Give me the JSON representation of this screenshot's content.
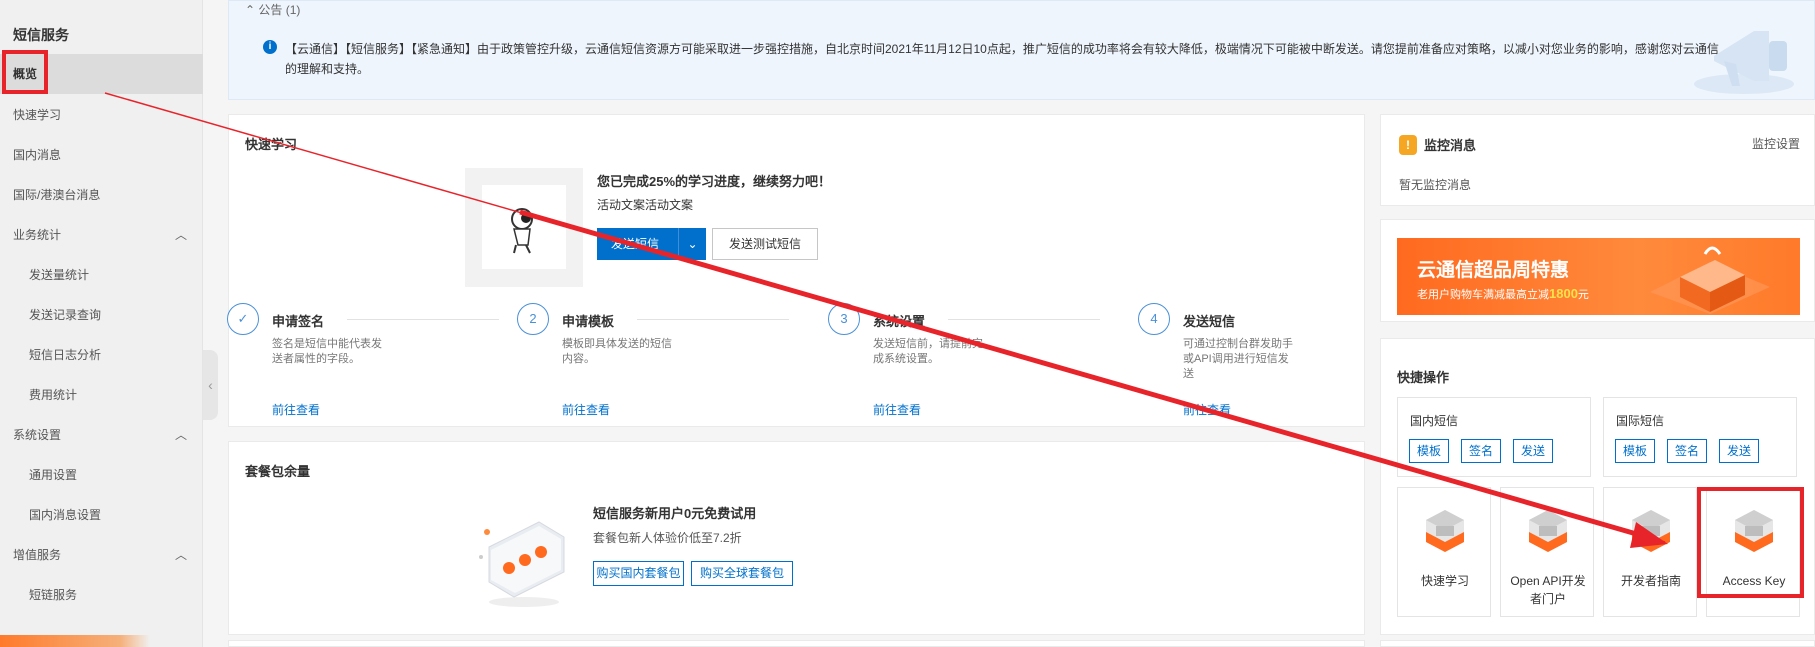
{
  "sidebar": {
    "title": "短信服务",
    "active_item": "概览",
    "items": [
      {
        "label": "快速学习",
        "sub": false,
        "expandable": false
      },
      {
        "label": "国内消息",
        "sub": false,
        "expandable": false
      },
      {
        "label": "国际/港澳台消息",
        "sub": false,
        "expandable": false
      },
      {
        "label": "业务统计",
        "sub": false,
        "expandable": true
      },
      {
        "label": "发送量统计",
        "sub": true,
        "expandable": false
      },
      {
        "label": "发送记录查询",
        "sub": true,
        "expandable": false
      },
      {
        "label": "短信日志分析",
        "sub": true,
        "expandable": false
      },
      {
        "label": "费用统计",
        "sub": true,
        "expandable": false
      },
      {
        "label": "系统设置",
        "sub": false,
        "expandable": true
      },
      {
        "label": "通用设置",
        "sub": true,
        "expandable": false
      },
      {
        "label": "国内消息设置",
        "sub": true,
        "expandable": false
      },
      {
        "label": "增值服务",
        "sub": false,
        "expandable": true
      },
      {
        "label": "短链服务",
        "sub": true,
        "expandable": false
      }
    ]
  },
  "notice": {
    "header": "公告 (1)",
    "text": "【云通信】【短信服务】【紧急通知】由于政策管控升级，云通信短信资源方可能采取进一步强控措施，自北京时间2021年11月12日10点起，推广短信的成功率将会有较大降低，极端情况下可能被中断发送。请您提前准备应对策略，以减小对您业务的影响，感谢您对云通信的理解和支持。"
  },
  "quick_learn": {
    "title": "快速学习",
    "progress_heading": "您已完成25%的学习进度，继续努力吧！",
    "progress_sub": "活动文案活动文案",
    "primary_button": "发送短信",
    "secondary_button": "发送测试短信",
    "steps": [
      {
        "num": "✓",
        "title": "申请签名",
        "desc": "签名是短信中能代表发送者属性的字段。",
        "link": "前往查看"
      },
      {
        "num": "2",
        "title": "申请模板",
        "desc": "模板即具体发送的短信内容。",
        "link": "前往查看"
      },
      {
        "num": "3",
        "title": "系统设置",
        "desc": "发送短信前，请提前完成系统设置。",
        "link": "前往查看"
      },
      {
        "num": "4",
        "title": "发送短信",
        "desc": "可通过控制台群发助手或API调用进行短信发送",
        "link": "前往查看"
      }
    ]
  },
  "package": {
    "title": "套餐包余量",
    "heading": "短信服务新用户0元免费试用",
    "sub": "套餐包新人体验价低至7.2折",
    "btn_domestic": "购买国内套餐包",
    "btn_global": "购买全球套餐包"
  },
  "monitor": {
    "title": "监控消息",
    "setting": "监控设置",
    "empty": "暂无监控消息"
  },
  "banner": {
    "title": "云通信超品周特惠",
    "sub_prefix": "老用户购物车满减最高立减",
    "amount": "1800",
    "sub_suffix": "元"
  },
  "quick_ops": {
    "title": "快捷操作",
    "domestic": {
      "title": "国内短信",
      "tags": [
        "模板",
        "签名",
        "发送"
      ]
    },
    "international": {
      "title": "国际短信",
      "tags": [
        "模板",
        "签名",
        "发送"
      ]
    },
    "tiles": [
      "快速学习",
      "Open API开发者门户",
      "开发者指南",
      "Access Key"
    ]
  },
  "colors": {
    "primary": "#0070cc",
    "annotation_red": "#e8242b",
    "banner_orange": "#ff7a2a"
  }
}
